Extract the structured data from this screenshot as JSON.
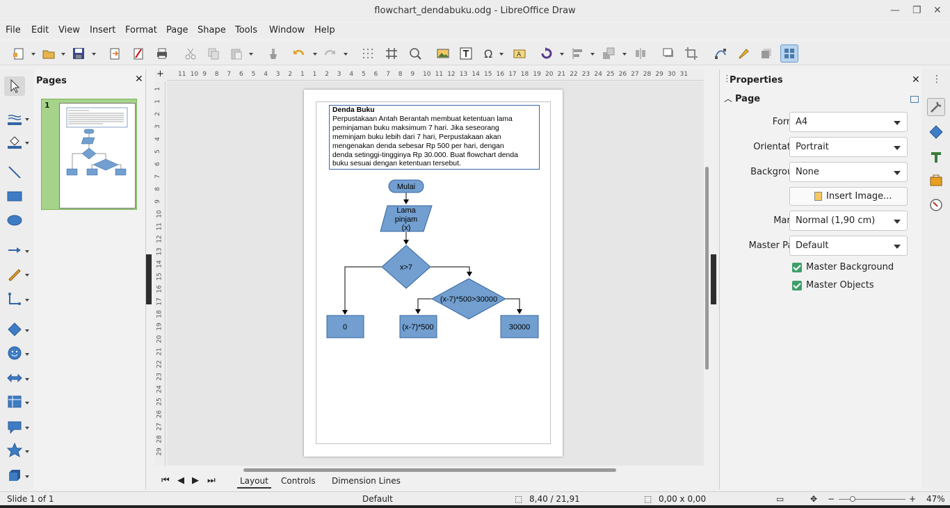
{
  "window": {
    "title": "flowchart_dendabuku.odg - LibreOffice Draw"
  },
  "menu": [
    "File",
    "Edit",
    "View",
    "Insert",
    "Format",
    "Page",
    "Shape",
    "Tools",
    "Window",
    "Help"
  ],
  "pages_panel": {
    "title": "Pages",
    "thumb_number": "1"
  },
  "document": {
    "textbox_title": "Denda Buku",
    "textbox_lines": [
      "Perpustakaan Antah Berantah membuat ketentuan lama",
      "peminjaman buku maksimum 7 hari. Jika seseorang",
      "meminjam buku lebih dari 7 hari, Perpustakaan akan",
      "mengenakan denda sebesar Rp 500 per hari, dengan",
      "denda setinggi-tingginya Rp 30.000. Buat flowchart denda",
      "buku sesuai dengan ketentuan tersebut."
    ],
    "flow": {
      "start": "Mulai",
      "input_lines": [
        "Lama",
        "pinjam",
        "(x)"
      ],
      "decision1": "x>7",
      "decision2": "(x-7)*500>30000",
      "out_zero": "0",
      "out_calc": "(x-7)*500",
      "out_max": "30000"
    }
  },
  "tabs": [
    "Layout",
    "Controls",
    "Dimension Lines"
  ],
  "properties": {
    "title": "Properties",
    "section": "Page",
    "format_label": "Format:",
    "format_value": "A4",
    "orientation_label": "Orientation:",
    "orientation_value": "Portrait",
    "background_label": "Background:",
    "background_value": "None",
    "insert_image": "Insert Image...",
    "margin_label": "Margin:",
    "margin_value": "Normal (1,90 cm)",
    "master_page_label": "Master Page:",
    "master_page_value": "Default",
    "master_background": "Master Background",
    "master_objects": "Master Objects"
  },
  "status": {
    "slide": "Slide 1 of 1",
    "layout": "Default",
    "position": "8,40 / 21,91",
    "size": "0,00 x 0,00",
    "zoom": "47%"
  },
  "ruler_h": [
    "11",
    "10",
    "9",
    "8",
    "7",
    "6",
    "5",
    "4",
    "3",
    "2",
    "1",
    "1",
    "2",
    "3",
    "4",
    "5",
    "6",
    "7",
    "8",
    "9",
    "10",
    "11",
    "12",
    "13",
    "14",
    "15",
    "16",
    "17",
    "18",
    "19",
    "20",
    "21",
    "22",
    "23",
    "24",
    "25",
    "26",
    "27",
    "28",
    "29",
    "30",
    "31"
  ],
  "ruler_v": [
    "1",
    "1",
    "2",
    "3",
    "4",
    "5",
    "6",
    "7",
    "8",
    "9",
    "10",
    "11",
    "12",
    "13",
    "14",
    "15",
    "16",
    "17",
    "18",
    "19",
    "20",
    "21",
    "22",
    "23",
    "24",
    "25",
    "26",
    "27",
    "28",
    "29"
  ],
  "colors": {
    "shape_fill": "#729fcf",
    "shape_stroke": "#3465a4",
    "accent_green": "#3f9f6a"
  }
}
